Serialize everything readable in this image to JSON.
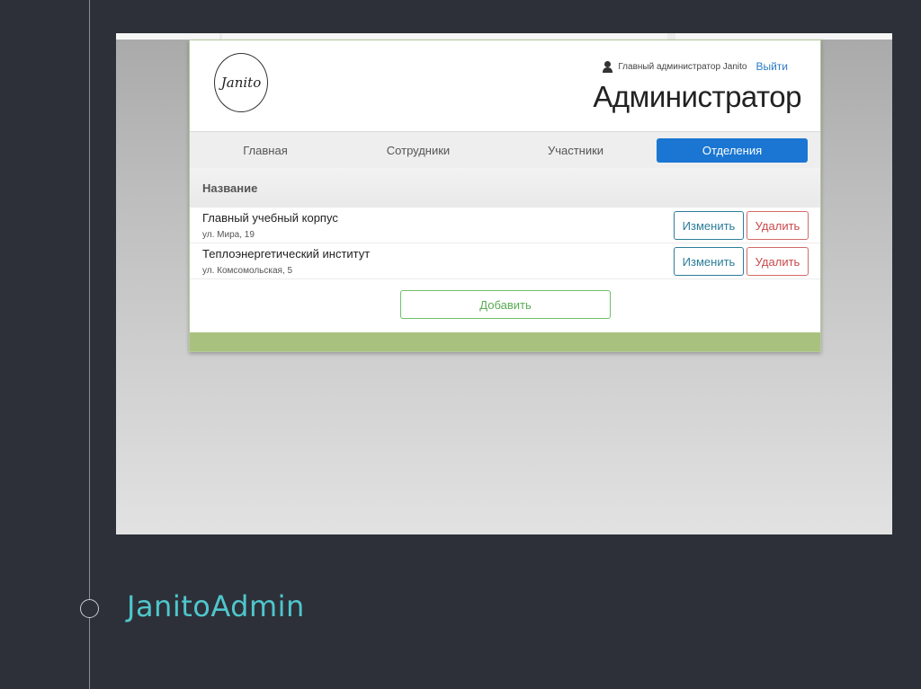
{
  "slide": {
    "caption": "JanitoAdmin"
  },
  "app": {
    "logo_text": "Janito",
    "user": {
      "icon": "user-icon",
      "label": "Главный администратор Janito",
      "logout": "Выйти"
    },
    "title": "Администратор",
    "nav": [
      {
        "label": "Главная",
        "active": false
      },
      {
        "label": "Сотрудники",
        "active": false
      },
      {
        "label": "Участники",
        "active": false
      },
      {
        "label": "Отделения",
        "active": true
      }
    ],
    "table": {
      "header": "Название",
      "rows": [
        {
          "name": "Главный учебный корпус",
          "address": "ул. Мира, 19",
          "edit_label": "Изменить",
          "delete_label": "Удалить"
        },
        {
          "name": "Теплоэнергетический институт",
          "address": "ул. Комсомольская, 5",
          "edit_label": "Изменить",
          "delete_label": "Удалить"
        }
      ],
      "add_label": "Добавить"
    }
  },
  "colors": {
    "slide_background": "#2d3038",
    "caption": "#4fc6cc",
    "active_tab": "#1a76d2",
    "footer": "#a9c17f",
    "edit_button": "#2c7d99",
    "delete_button": "#c94a4a",
    "add_button": "#5aaa55"
  }
}
